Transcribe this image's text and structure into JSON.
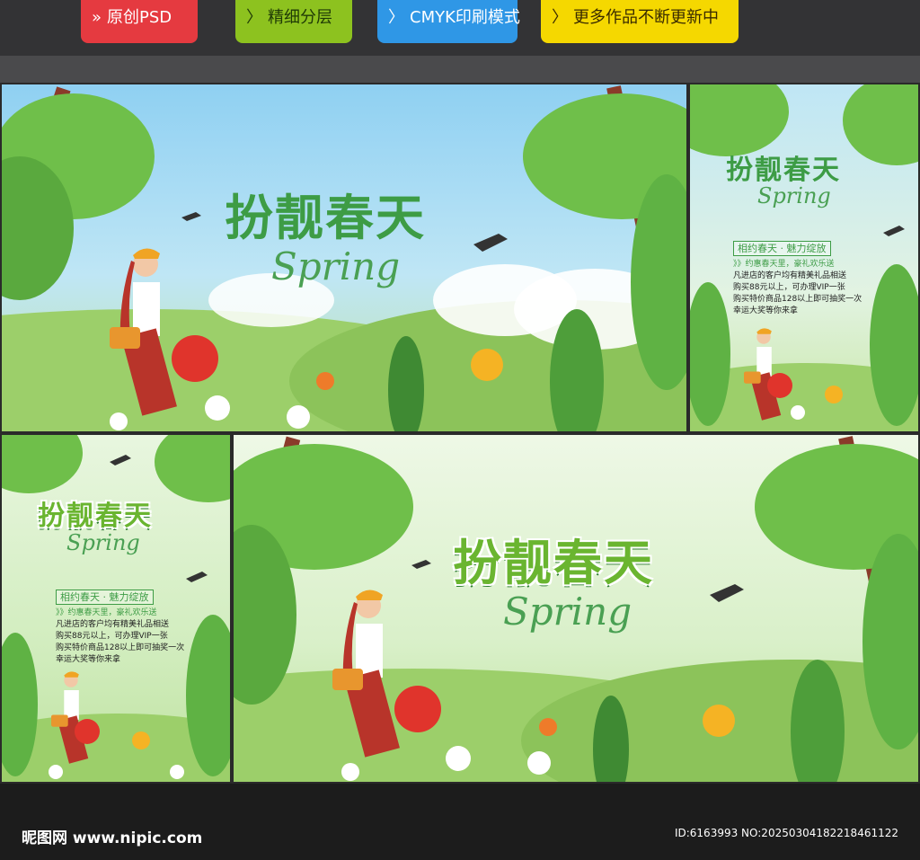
{
  "tags": [
    {
      "icon": "double-chevron-icon",
      "label": "原创PSD"
    },
    {
      "icon": "chevron-icon",
      "label": "精细分层"
    },
    {
      "icon": "chevron-icon",
      "label": "CMYK印刷模式"
    },
    {
      "icon": "chevron-icon",
      "label": "更多作品不断更新中"
    }
  ],
  "poster": {
    "headline": "扮靓春天",
    "script_word": "Spring",
    "subtitle": "相约春天 · 魅力绽放",
    "intro": "》》约惠春天里，豪礼欢乐送",
    "lines": [
      "凡进店的客户均有精美礼品相送",
      "购买88元以上，可办理VIP一张",
      "购买特价商品128以上即可抽奖一次",
      "幸运大奖等你来拿"
    ]
  },
  "footer": {
    "logo": "昵图网 www.nipic.com",
    "id_text": "ID:6163993 NO:20250304182218461122"
  },
  "colors": {
    "red_tag": "#e53a40",
    "green_tag": "#8dc21f",
    "blue_tag": "#2f97e6",
    "yellow_tag": "#f5d800",
    "headline_green": "#3d9c45"
  }
}
